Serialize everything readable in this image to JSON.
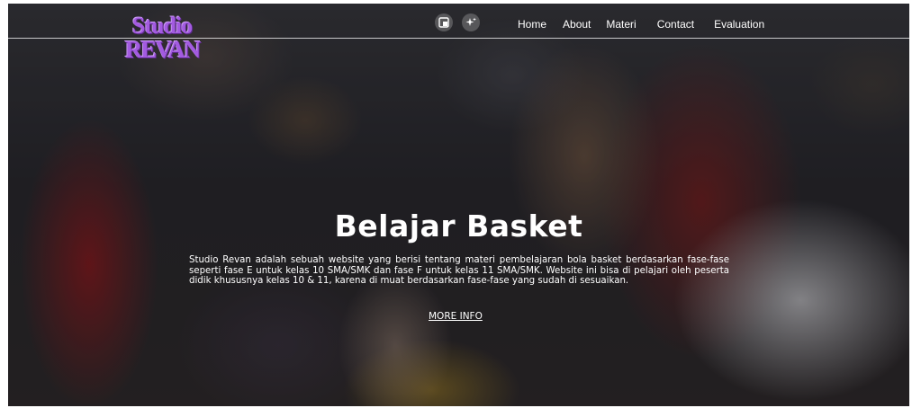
{
  "logo": {
    "line1": "Studio",
    "line2": "REVAN"
  },
  "toolbar_icons": [
    {
      "icon": "picture-in-picture-icon"
    },
    {
      "icon": "sparkle-icon"
    }
  ],
  "nav": {
    "items": [
      "Home",
      "About",
      "Materi",
      "Contact",
      "Evaluation"
    ]
  },
  "hero": {
    "title": "Belajar Basket",
    "description": "Studio Revan adalah sebuah website yang berisi tentang materi pembelajaran bola basket berdasarkan fase-fase seperti fase E untuk kelas 10 SMA/SMK dan fase F untuk kelas 11 SMA/SMK. Website ini bisa di pelajari oleh peserta didik khususnya kelas 10 & 11, karena di muat berdasarkan fase-fase yang sudah di sesuaikan.",
    "cta": "MORE INFO"
  },
  "colors": {
    "logo": "#a35be0",
    "text": "#ffffff"
  }
}
